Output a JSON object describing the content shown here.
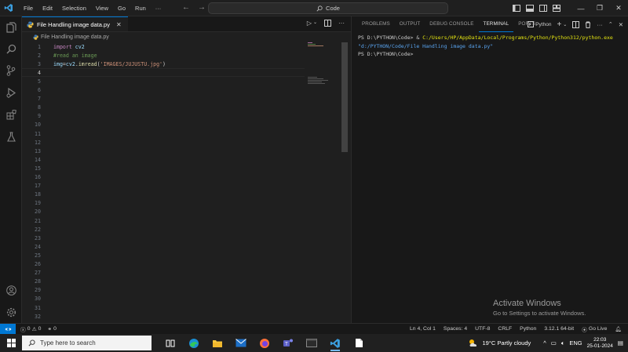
{
  "titlebar": {
    "menu": [
      "File",
      "Edit",
      "Selection",
      "View",
      "Go",
      "Run",
      "···"
    ],
    "search_text": "Code"
  },
  "editor": {
    "tab_label": "File Handling image data.py",
    "breadcrumb": "File Handling image data.py",
    "lines": [
      {
        "n": "1",
        "tokens": [
          {
            "t": "import",
            "c": "kw"
          },
          {
            "t": " cv2",
            "c": "id"
          }
        ]
      },
      {
        "n": "2",
        "tokens": [
          {
            "t": "#read an image",
            "c": "cm"
          }
        ]
      },
      {
        "n": "3",
        "tokens": [
          {
            "t": "img",
            "c": "id"
          },
          {
            "t": "=",
            "c": "plain"
          },
          {
            "t": "cv2",
            "c": "id"
          },
          {
            "t": ".",
            "c": "plain"
          },
          {
            "t": "imread",
            "c": "fn"
          },
          {
            "t": "(",
            "c": "plain"
          },
          {
            "t": "'IMAGES/JUJUSTU.jpg'",
            "c": "str"
          },
          {
            "t": ")",
            "c": "plain"
          }
        ]
      },
      {
        "n": "4",
        "tokens": []
      },
      {
        "n": "5",
        "tokens": []
      },
      {
        "n": "6",
        "tokens": []
      },
      {
        "n": "7",
        "tokens": []
      },
      {
        "n": "8",
        "tokens": []
      },
      {
        "n": "9",
        "tokens": []
      },
      {
        "n": "10",
        "tokens": []
      },
      {
        "n": "11",
        "tokens": []
      },
      {
        "n": "12",
        "tokens": []
      },
      {
        "n": "13",
        "tokens": []
      },
      {
        "n": "14",
        "tokens": []
      },
      {
        "n": "15",
        "tokens": []
      },
      {
        "n": "16",
        "tokens": []
      },
      {
        "n": "17",
        "tokens": []
      },
      {
        "n": "18",
        "tokens": []
      },
      {
        "n": "19",
        "tokens": []
      },
      {
        "n": "20",
        "tokens": []
      },
      {
        "n": "21",
        "tokens": []
      },
      {
        "n": "22",
        "tokens": []
      },
      {
        "n": "23",
        "tokens": []
      },
      {
        "n": "24",
        "tokens": []
      },
      {
        "n": "25",
        "tokens": []
      },
      {
        "n": "26",
        "tokens": []
      },
      {
        "n": "27",
        "tokens": []
      },
      {
        "n": "28",
        "tokens": []
      },
      {
        "n": "29",
        "tokens": []
      },
      {
        "n": "30",
        "tokens": []
      },
      {
        "n": "31",
        "tokens": []
      },
      {
        "n": "32",
        "tokens": []
      }
    ],
    "active_line": "4"
  },
  "panel": {
    "tabs": [
      "PROBLEMS",
      "OUTPUT",
      "DEBUG CONSOLE",
      "TERMINAL",
      "PORTS"
    ],
    "active_tab": "TERMINAL",
    "shell_label": "Python",
    "terminal": {
      "prompt1": "PS D:\\PYTHON\\Code> ",
      "amp": "& ",
      "exe_path": "C:/Users/HP/AppData/Local/Programs/Python/Python312/python.exe",
      "script_path": "\"d:/PYTHON/Code/File Handling image data.py\"",
      "prompt2": "PS D:\\PYTHON\\Code>"
    }
  },
  "watermark": {
    "title": "Activate Windows",
    "subtitle": "Go to Settings to activate Windows."
  },
  "statusbar": {
    "errors": "0",
    "warnings": "0",
    "ports": "0",
    "position": "Ln 4, Col 1",
    "spaces": "Spaces: 4",
    "encoding": "UTF-8",
    "eol": "CRLF",
    "language": "Python",
    "interpreter": "3.12.1 64-bit",
    "golive": "Go Live"
  },
  "taskbar": {
    "search_placeholder": "Type here to search",
    "weather": "19°C  Partly cloudy",
    "lang": "ENG",
    "time": "22:03",
    "date": "25-01-2024"
  },
  "colors": {
    "accent": "#0078d4",
    "editor_bg": "#1f1f1f",
    "panel_bg": "#181818"
  }
}
